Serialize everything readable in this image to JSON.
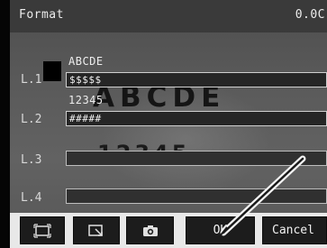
{
  "header": {
    "title": "Format",
    "value": "0.0C"
  },
  "lines": [
    {
      "label": "L.1",
      "format": "$$$$$",
      "sample": "ABCDE"
    },
    {
      "label": "L.2",
      "format": "#####",
      "sample": "12345"
    },
    {
      "label": "L.3",
      "format": ""
    },
    {
      "label": "L.4",
      "format": ""
    }
  ],
  "image": {
    "printed_line_1": "ABCDE",
    "printed_line_2": "12345"
  },
  "toolbar": {
    "frame_icon": "frame-icon",
    "zoom_icon": "zoom-window-icon",
    "camera_icon": "camera-icon",
    "ok_label": "OK",
    "cancel_label": "Cancel"
  },
  "colors": {
    "panel": "#3a3a3a",
    "button": "#1c1c1c",
    "text": "#ececec"
  }
}
